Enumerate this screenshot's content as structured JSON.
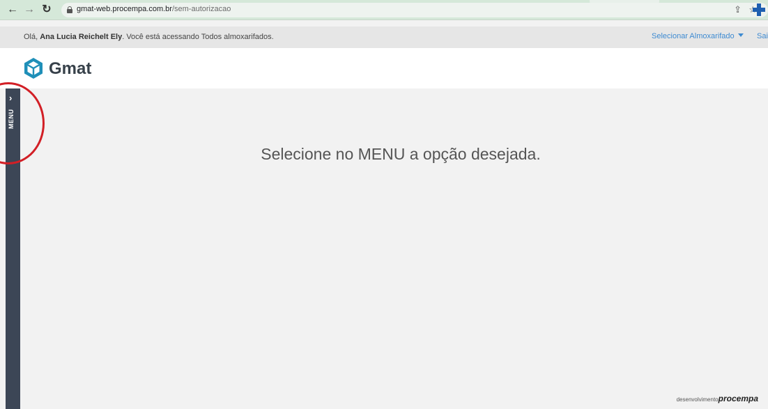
{
  "browser": {
    "url_host": "gmat-web.procempa.com.br",
    "url_path": "/sem-autorizacao"
  },
  "user_bar": {
    "greeting_prefix": "Olá, ",
    "user_name": "Ana Lucia Reichelt Ely",
    "greeting_suffix": ". Você está acessando Todos almoxarifados.",
    "select_almox_label": "Selecionar Almoxarifado",
    "logout_label": "Sai"
  },
  "header": {
    "app_name": "Gmat",
    "logo_icon": "box-hexagon-icon"
  },
  "side_menu": {
    "label": "MENU",
    "toggle_icon": "chevron-right-icon"
  },
  "main": {
    "message": "Selecione no MENU a opção desejada."
  },
  "footer": {
    "credit_prefix": "desenvolvimento",
    "credit_brand": "procempa"
  },
  "colors": {
    "browser_bar": "#d5e8d9",
    "side_menu": "#3c4656",
    "link": "#3d8ad1",
    "logo": "#1f8fb8",
    "annotation": "#d21f26"
  }
}
